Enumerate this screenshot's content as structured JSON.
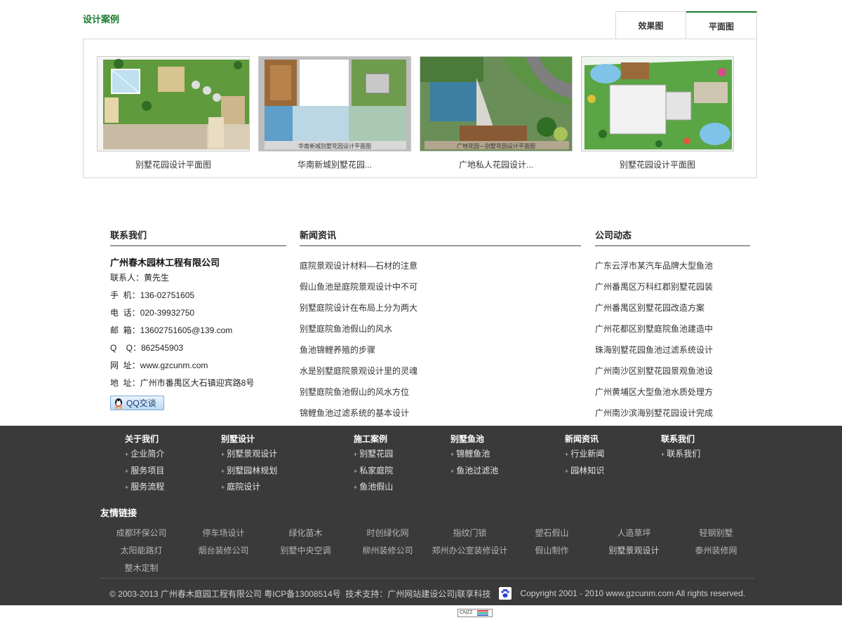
{
  "cases": {
    "title": "设计案例",
    "tabs": [
      {
        "label": "效果图",
        "active": false
      },
      {
        "label": "平面图",
        "active": true
      }
    ],
    "items": [
      {
        "caption": "别墅花园设计平面图",
        "image_text": ""
      },
      {
        "caption": "华南新城别墅花园...",
        "image_text": "华南新城别墅花园设计平面图"
      },
      {
        "caption": "广地私人花园设计...",
        "image_text": "广地花园—别墅花园设计平面图"
      },
      {
        "caption": "别墅花园设计平面图",
        "image_text": ""
      }
    ]
  },
  "contact": {
    "title": "联系我们",
    "company": "广州春木园林工程有限公司",
    "lines": [
      "联系人：黄先生",
      "手  机：136-02751605",
      "电  话：020-39932750",
      "邮  箱：13602751605@139.com",
      "Q    Q：862545903",
      "网  址：www.gzcunm.com",
      "地  址：广州市番禺区大石镇迎宾路8号"
    ],
    "qq_button": "QQ交谈"
  },
  "news": {
    "title": "新闻资讯",
    "items": [
      "庭院景观设计材料—石材的注意",
      "假山鱼池是庭院景观设计中不可",
      "别墅庭院设计在布局上分为两大",
      "别墅庭院鱼池假山的风水",
      "鱼池锦鲤养殖的步骤",
      "水是别墅庭院景观设计里的灵魂",
      "别墅庭院鱼池假山的风水方位",
      "锦鲤鱼池过滤系统的基本设计"
    ]
  },
  "dynamics": {
    "title": "公司动态",
    "items": [
      "广东云浮市某汽车品牌大型鱼池",
      "广州番禺区万科红郡别墅花园装",
      "广州番禺区别墅花园改造方案",
      "广州花都区别墅庭院鱼池建造中",
      "珠海别墅花园鱼池过滤系统设计",
      "广州南沙区别墅花园景观鱼池设",
      "广州黄埔区大型鱼池水质处理方",
      "广州南沙滨海别墅花园设计完成"
    ]
  },
  "footer": {
    "columns": [
      {
        "title": "关于我们",
        "items": [
          "企业简介",
          "服务项目",
          "服务流程"
        ]
      },
      {
        "title": "别墅设计",
        "items": [
          "别墅景观设计",
          "别墅园林规划",
          "庭院设计"
        ]
      },
      {
        "title": "施工案例",
        "items": [
          "别墅花园",
          "私家庭院",
          "鱼池假山"
        ]
      },
      {
        "title": "别墅鱼池",
        "items": [
          "锦鲤鱼池",
          "鱼池过滤池"
        ]
      },
      {
        "title": "新闻资讯",
        "items": [
          "行业新闻",
          "园林知识"
        ]
      },
      {
        "title": "联系我们",
        "items": [
          "联系我们"
        ]
      }
    ],
    "links_title": "友情链接",
    "links": [
      [
        "成都环保公司",
        "停车场设计",
        "绿化苗木",
        "时创绿化网",
        "指纹门锁",
        "塑石假山",
        "人造草坪",
        "轻钢别墅"
      ],
      [
        "太阳能路灯",
        "烟台装修公司",
        "别墅中央空调",
        "柳州装修公司",
        "郑州办公室装修设计",
        "假山制作",
        "别墅景观设计",
        "泰州装修网"
      ],
      [
        "整木定制"
      ]
    ],
    "copyright_left": "© 2003-2013 广州春木庭园工程有限公司 粤ICP备13008514号  技术支持：广州网站建设公司|联享科技",
    "copyright_right": "Copyright 2001 - 2010 www.gzcunm.com All rights reserved.",
    "counter_label": "CNZZ"
  },
  "colors": {
    "accent": "#1a7a2e",
    "footer_bg": "#3a3a3a"
  }
}
